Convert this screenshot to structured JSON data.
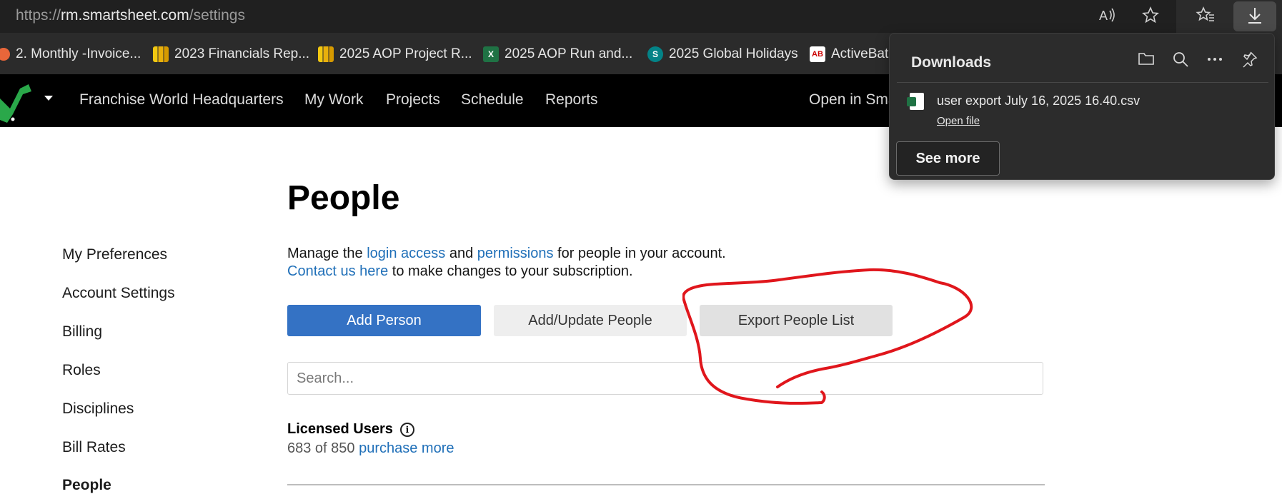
{
  "browser": {
    "url_scheme": "https://",
    "url_host": "rm.smartsheet.com",
    "url_path": "/settings",
    "icons": [
      "read-aloud-icon",
      "favorite-star-icon",
      "favorites-icon",
      "downloads-icon"
    ]
  },
  "bookmarks": [
    {
      "label": "2. Monthly -Invoice...",
      "icon": "monthly-invoice-icon"
    },
    {
      "label": "2023 Financials Rep...",
      "icon": "power-bi-icon"
    },
    {
      "label": "2025 AOP Project R...",
      "icon": "power-bi-icon"
    },
    {
      "label": "2025 AOP Run and...",
      "icon": "excel-icon"
    },
    {
      "label": "2025 Global Holidays",
      "icon": "sharepoint-icon"
    },
    {
      "label": "ActiveBatc",
      "icon": "activebatch-icon"
    }
  ],
  "appnav": {
    "items": [
      "Franchise World Headquarters",
      "My Work",
      "Projects",
      "Schedule",
      "Reports"
    ],
    "right_label": "Open in Sma"
  },
  "sidebar": {
    "items": [
      "My Preferences",
      "Account Settings",
      "Billing",
      "Roles",
      "Disciplines",
      "Bill Rates",
      "People"
    ],
    "active": "People"
  },
  "main": {
    "title": "People",
    "desc_1a": "Manage the ",
    "desc_link_login": "login access",
    "desc_1b": " and ",
    "desc_link_permissions": "permissions",
    "desc_1c": " for people in your account.",
    "desc_link_contact": "Contact us here",
    "desc_2": " to make changes to your subscription.",
    "buttons": {
      "add_person": "Add Person",
      "add_update": "Add/Update People",
      "export": "Export People List"
    },
    "search_placeholder": "Search...",
    "licensed_users_label": "Licensed Users",
    "licensed_count": "683 of 850 ",
    "purchase_more": "purchase more"
  },
  "downloads": {
    "title": "Downloads",
    "file_name": "user export July 16, 2025 16.40.csv",
    "open_file": "Open file",
    "see_more": "See more"
  },
  "colors": {
    "accent_blue": "#3472c4",
    "link_blue": "#1f6fb8",
    "annotation_red": "#e0161c",
    "nav_bg": "#000000"
  }
}
